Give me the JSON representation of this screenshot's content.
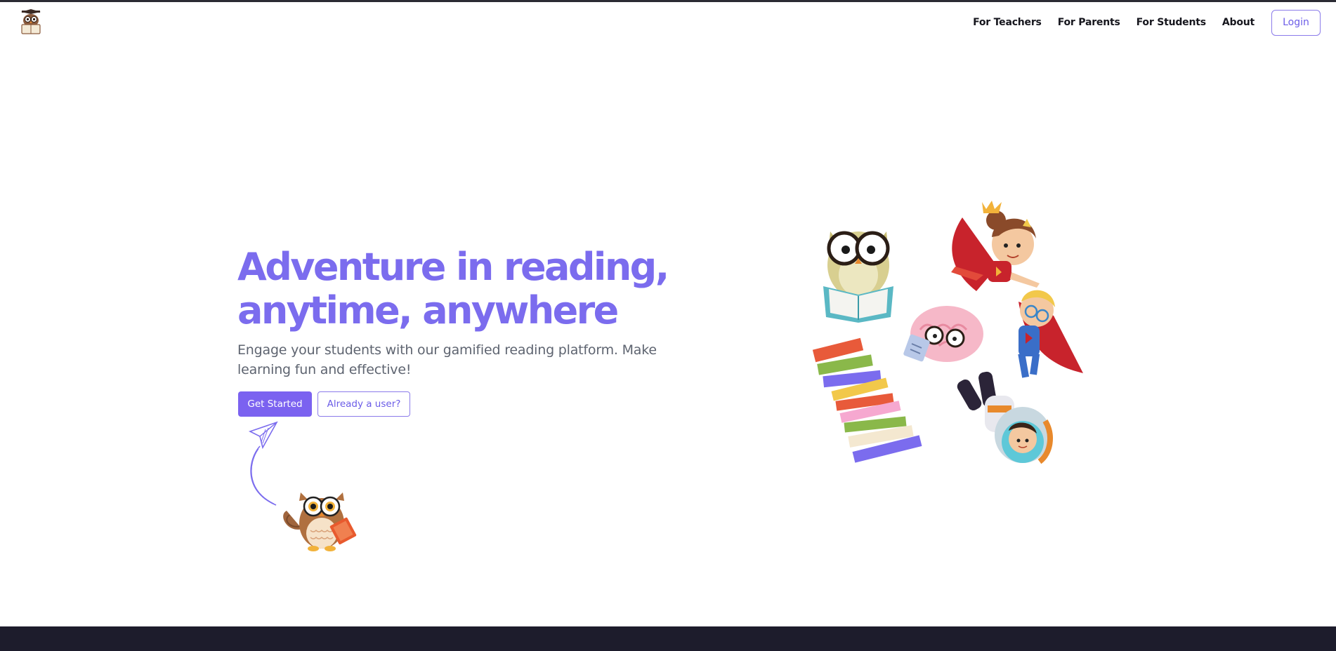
{
  "nav": {
    "links": [
      "For Teachers",
      "For Parents",
      "For Students",
      "About"
    ],
    "login_label": "Login"
  },
  "hero": {
    "title_line1": "Adventure in reading,",
    "title_line2": "anytime, anywhere",
    "subtitle": "Engage your students with our gamified reading platform. Make learning fun and effective!",
    "primary_button": "Get Started",
    "secondary_button": "Already a user?"
  },
  "colors": {
    "accent": "#7b6cee",
    "button_primary": "#7b62f0",
    "footer_bg": "#1d1c2c",
    "text_dark": "#16161d",
    "text_muted": "#5e6470"
  },
  "icons": {
    "logo": "owl-reading-logo-icon",
    "plane": "paper-plane-icon",
    "owl": "owl-with-book-icon",
    "illustration": "reading-characters-illustration"
  }
}
